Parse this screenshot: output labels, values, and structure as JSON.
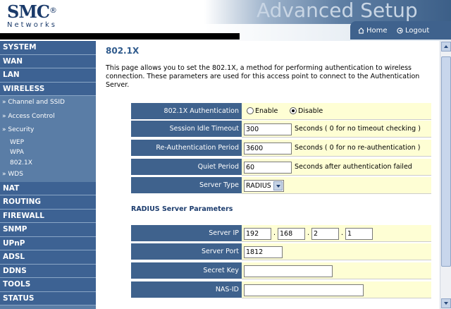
{
  "header": {
    "logo_main": "SMC",
    "logo_reg": "®",
    "logo_sub": "Networks",
    "banner_text": "Advanced Setup",
    "home_label": "Home",
    "logout_label": "Logout"
  },
  "sidebar": {
    "system": "SYSTEM",
    "wan": "WAN",
    "lan": "LAN",
    "wireless": "WIRELESS",
    "channel_ssid": "» Channel and SSID",
    "access_control": "» Access Control",
    "security": "» Security",
    "wep": "WEP",
    "wpa": "WPA",
    "dot1x": "802.1X",
    "wds": "» WDS",
    "nat": "NAT",
    "routing": "ROUTING",
    "firewall": "FIREWALL",
    "snmp": "SNMP",
    "upnp": "UPnP",
    "adsl": "ADSL",
    "ddns": "DDNS",
    "tools": "TOOLS",
    "status": "STATUS"
  },
  "main": {
    "title": "802.1X",
    "description": "This page allows you to set the 802.1X, a method for performing authentication to wireless connection.  These parameters are used for this access point to connect to the Authentication Server.",
    "auth_label": "802.1X Authentication",
    "enable_label": "Enable",
    "disable_label": "Disable",
    "session_label": "Session Idle Timeout",
    "session_value": "300",
    "session_note": "Seconds ( 0 for no timeout checking )",
    "reauth_label": "Re-Authentication Period",
    "reauth_value": "3600",
    "reauth_note": "Seconds ( 0 for no re-authentication )",
    "quiet_label": "Quiet Period",
    "quiet_value": "60",
    "quiet_note": "Seconds after authentication failed",
    "server_type_label": "Server Type",
    "server_type_value": "RADIUS",
    "radius_heading": "RADIUS Server Parameters",
    "server_ip_label": "Server IP",
    "ip1": "192",
    "ip2": "168",
    "ip3": "2",
    "ip4": "1",
    "dot": ".",
    "server_port_label": "Server Port",
    "server_port_value": "1812",
    "secret_key_label": "Secret Key",
    "secret_key_value": "",
    "nas_id_label": "NAS-ID",
    "nas_id_value": ""
  },
  "colors": {
    "sidebar_bg": "#5a7da6",
    "label_bg": "#3f628d",
    "value_bg": "#fefed4",
    "title_color": "#2f5a8c"
  }
}
